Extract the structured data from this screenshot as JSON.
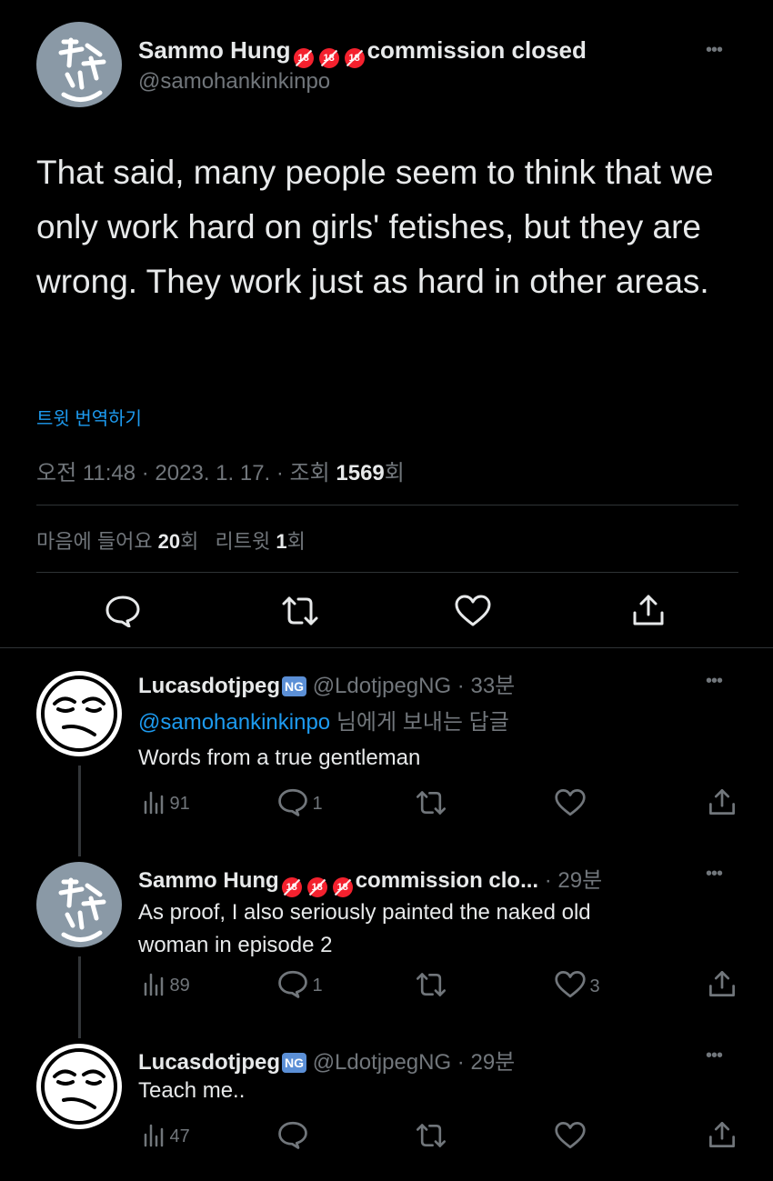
{
  "main_tweet": {
    "display_name": "Sammo Hung",
    "badge": "18",
    "name_suffix": "commission closed",
    "handle": "@samohankinkinpo",
    "more": "•••",
    "text": "That said, many people seem to think that we only work hard on girls' fetishes, but they are wrong. They work just as hard in other areas.",
    "translate_label": "트윗 번역하기",
    "time": "오전 11:48 · 2023. 1. 17. · 조회 ",
    "views_count": "1569",
    "views_unit": "회",
    "likes_label": "마음에 들어요 ",
    "likes_count": "20",
    "likes_unit": "회",
    "retweets_label": "리트윗 ",
    "retweets_count": "1",
    "retweets_unit": "회"
  },
  "replies": [
    {
      "display_name": "Lucasdotjpeg",
      "ng_badge": "NG",
      "handle": "@LdotjpegNG",
      "time": " · 33분",
      "reply_to_handle": "@samohankinkinpo",
      "reply_to_suffix": " 님에게 보내는 답글",
      "text": "Words from a true gentleman",
      "views": "91",
      "replies": "1",
      "retweets": "",
      "likes": ""
    },
    {
      "display_name": "Sammo Hung",
      "badge": "18",
      "name_suffix": "commission clo...",
      "time": " · 29분",
      "text_line1": "As proof, I also seriously painted the naked old",
      "text_line2": "woman in episode 2",
      "views": "89",
      "replies": "1",
      "retweets": "",
      "likes": "3"
    },
    {
      "display_name": "Lucasdotjpeg",
      "ng_badge": "NG",
      "handle": "@LdotjpegNG",
      "time": " · 29분",
      "text": "Teach me..",
      "views": "47",
      "replies": "",
      "retweets": "",
      "likes": ""
    }
  ],
  "colors": {
    "background": "#000000",
    "text": "#e7e9ea",
    "muted": "#71767b",
    "link": "#1d9bf0",
    "badge": "#f4212e"
  }
}
